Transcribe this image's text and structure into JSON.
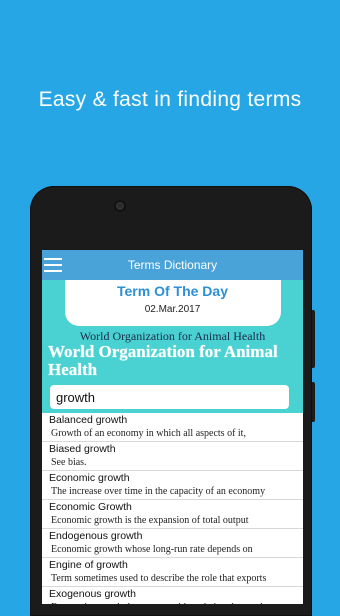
{
  "promo": {
    "headline": "Easy & fast in finding terms"
  },
  "app": {
    "title": "Terms Dictionary",
    "term_of_day": {
      "heading": "Term Of The Day",
      "date": "02.Mar.2017",
      "term_small": "World Organization for Animal Health",
      "term_large": "World Organization for Animal Health"
    },
    "search": {
      "value": "growth",
      "placeholder": ""
    },
    "results": [
      {
        "term": "Balanced growth",
        "definition": "Growth of an economy in which all aspects of it,"
      },
      {
        "term": "Biased growth",
        "definition": "See bias."
      },
      {
        "term": "Economic growth",
        "definition": "The increase over time in the capacity of an economy"
      },
      {
        "term": "Economic Growth",
        "definition": "Economic growth is the expansion of total output"
      },
      {
        "term": "Endogenous growth",
        "definition": "Economic growth whose long-run rate depends on"
      },
      {
        "term": "Engine of growth",
        "definition": "Term sometimes used to describe the role that exports"
      },
      {
        "term": "Exogenous growth",
        "definition": "Economic growth that occurs without being the result"
      }
    ]
  },
  "colors": {
    "background": "#27a6e6",
    "appbar": "#4aa3d8",
    "content": "#4ad1d1",
    "accent": "#2d8fd4"
  }
}
